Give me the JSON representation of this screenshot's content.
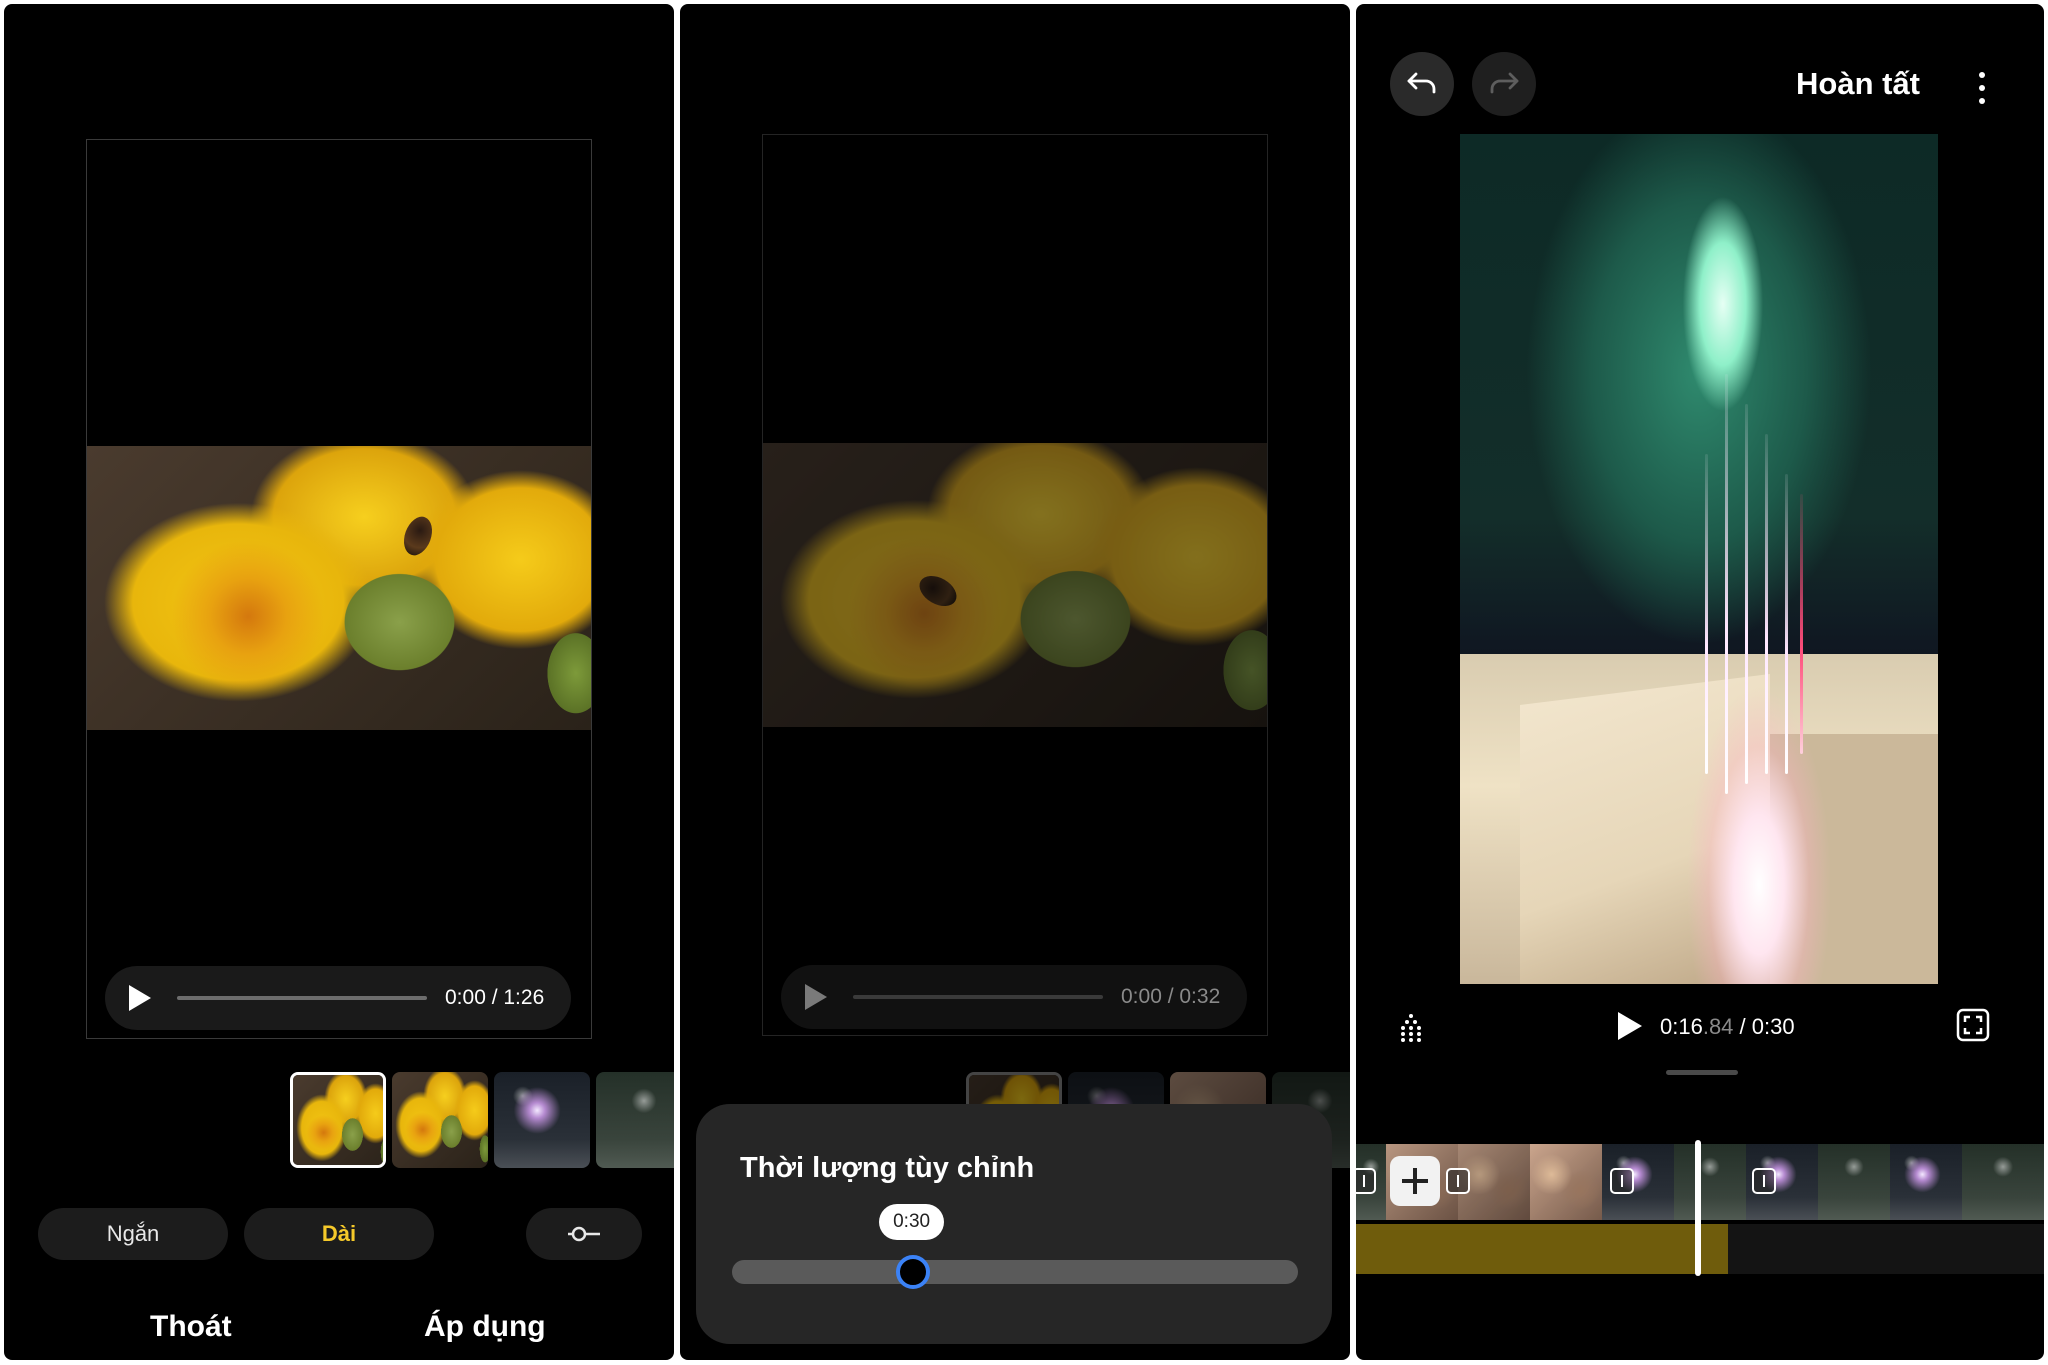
{
  "screen1": {
    "player": {
      "time": "0:00 / 1:26"
    },
    "length_options": {
      "short": "Ngắn",
      "long": "Dài"
    },
    "actions": {
      "exit": "Thoát",
      "apply": "Áp dụng"
    }
  },
  "screen2": {
    "player": {
      "time": "0:00 / 0:32"
    },
    "sheet": {
      "title": "Thời lượng tùy chỉnh",
      "slider_value": "0:30",
      "slider_fraction": 0.32
    }
  },
  "screen3": {
    "header": {
      "done": "Hoàn tất"
    },
    "player": {
      "current": "0:16",
      "current_fraction": ".84",
      "total": "/ 0:30"
    },
    "timeline": {
      "audio_progress_fraction": 0.54
    }
  },
  "colors": {
    "accent_yellow": "#f5c92a",
    "slider_blue": "#3b82f6",
    "audio_track": "#6f5c0c"
  },
  "icons": [
    "play-icon",
    "slider-adjust-icon",
    "undo-icon",
    "redo-icon",
    "more-vert-icon",
    "level-meter-icon",
    "fullscreen-icon",
    "add-icon"
  ]
}
